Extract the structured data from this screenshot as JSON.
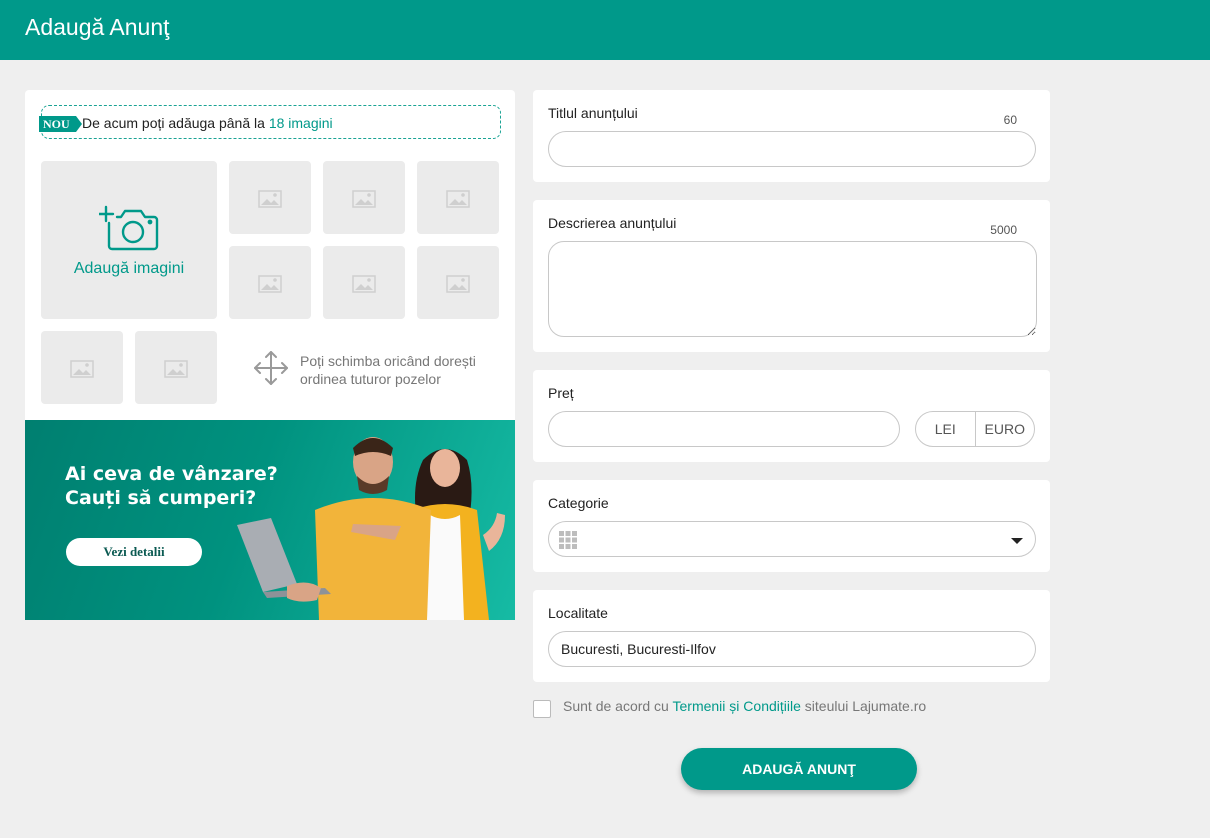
{
  "header": {
    "title": "Adaugă Anunţ"
  },
  "images": {
    "badge": "NOU",
    "notice_prefix": "De acum poți adăuga până la",
    "notice_highlight": "18 imagini",
    "add_label": "Adaugă imagini",
    "reorder_line1": "Poți schimba oricând dorești",
    "reorder_line2": "ordinea tuturor pozelor"
  },
  "banner": {
    "line1": "Ai ceva de vânzare?",
    "line2": "Cauți să cumperi?",
    "button": "Vezi detalii"
  },
  "form": {
    "title_label": "Titlul anunțului",
    "title_counter": "60",
    "title_value": "",
    "description_label": "Descrierea anunțului",
    "description_counter": "5000",
    "description_value": "",
    "price_label": "Preț",
    "price_value": "",
    "currency_options": [
      "LEI",
      "EURO"
    ],
    "category_label": "Categorie",
    "location_label": "Localitate",
    "location_value": "Bucuresti, Bucuresti-Ilfov"
  },
  "agreement": {
    "prefix": "Sunt de acord cu",
    "link": "Termenii și Condițiile",
    "suffix": "siteului Lajumate.ro"
  },
  "submit_label": "ADAUGĂ ANUNŢ",
  "colors": {
    "brand": "#00998a",
    "background": "#efefef"
  }
}
